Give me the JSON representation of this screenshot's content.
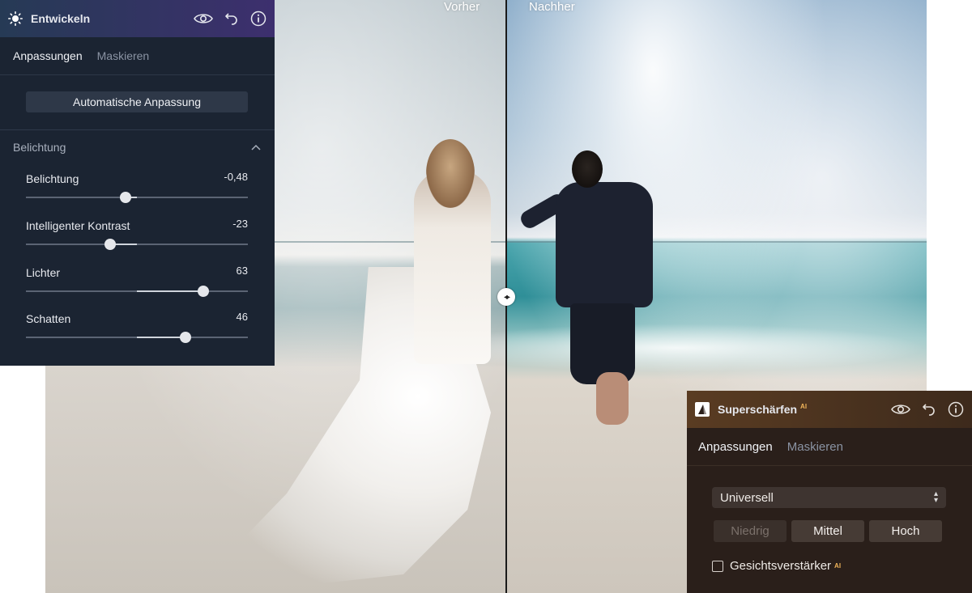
{
  "develop": {
    "title": "Entwickeln",
    "tabs": [
      "Anpassungen",
      "Maskieren"
    ],
    "auto_button": "Automatische Anpassung",
    "section": "Belichtung",
    "sliders": [
      {
        "label": "Belichtung",
        "value": "-0,48",
        "position": 0.45
      },
      {
        "label": "Intelligenter Kontrast",
        "value": "-23",
        "position": 0.38
      },
      {
        "label": "Lichter",
        "value": "63",
        "position": 0.8
      },
      {
        "label": "Schatten",
        "value": "46",
        "position": 0.72
      }
    ]
  },
  "compare": {
    "before": "Vorher",
    "after": "Nachher"
  },
  "sharpen": {
    "title": "Superschärfen",
    "ai_badge": "AI",
    "tabs": [
      "Anpassungen",
      "Maskieren"
    ],
    "mode": "Universell",
    "levels": [
      "Niedrig",
      "Mittel",
      "Hoch"
    ],
    "face_enhancer": "Gesichtsverstärker",
    "face_enhancer_badge": "AI"
  },
  "icons": {
    "develop": "sun-icon",
    "sharpen": "sharpen-triangle-icon",
    "visibility": "eye-icon",
    "reset": "undo-icon",
    "info": "info-icon"
  },
  "colors": {
    "develop_header_start": "#263a55",
    "develop_header_end": "#3d2f6e",
    "develop_bg": "#1b2432",
    "sharpen_header": "#5a3c22",
    "sharpen_bg": "#2a1f1a",
    "ai_badge": "#f0b45a"
  }
}
